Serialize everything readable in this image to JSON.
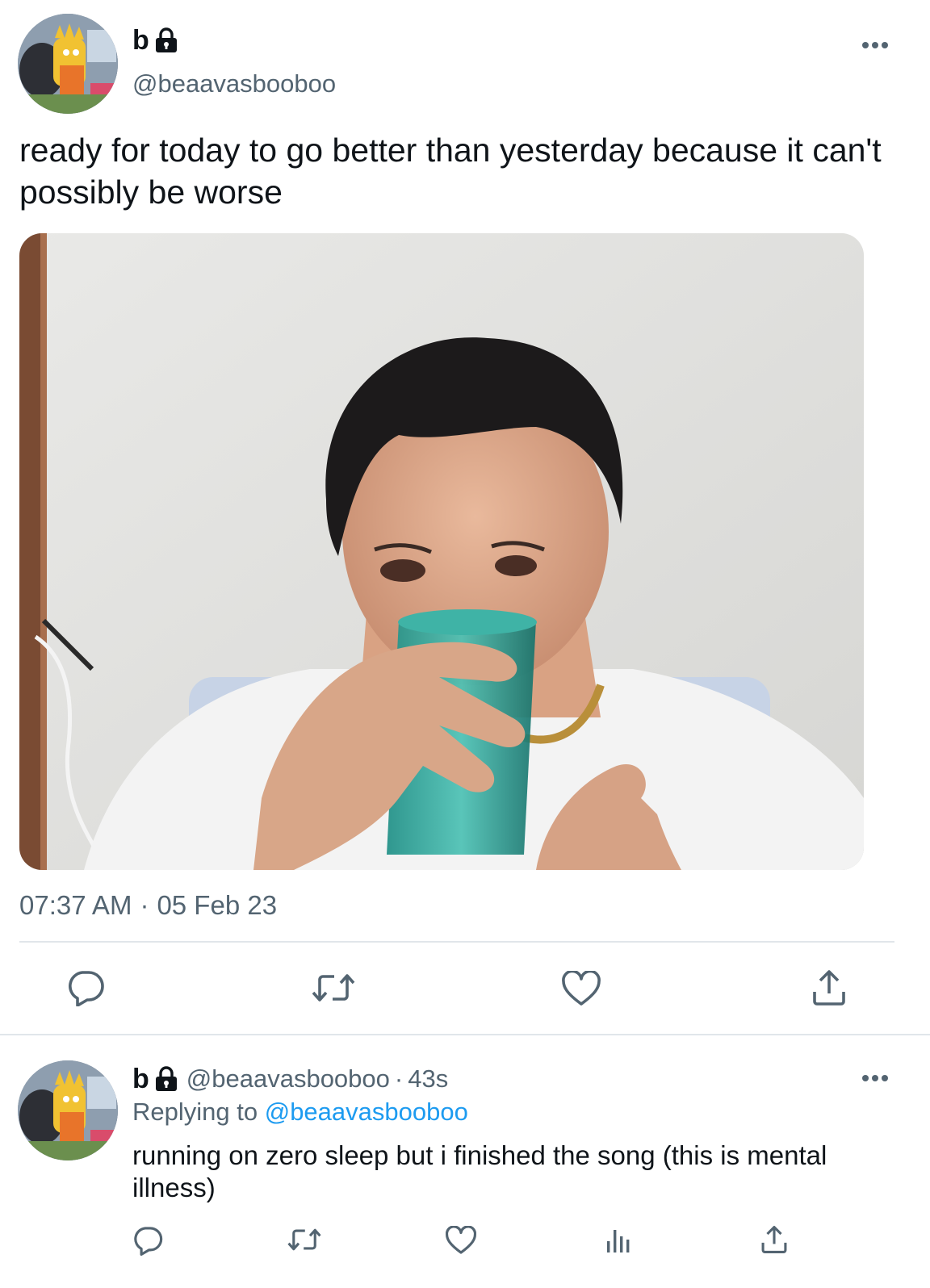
{
  "tweet": {
    "author_name": "b",
    "author_handle": "@beaavasbooboo",
    "text": "ready for today to go better than yesterday because it can't possibly be worse",
    "time": "07:37 AM",
    "separator": "·",
    "date": "05 Feb 23",
    "icons": {
      "lock": "lock-icon",
      "more": "more-icon",
      "reply": "reply-icon",
      "retweet": "retweet-icon",
      "like": "like-icon",
      "share": "share-icon"
    }
  },
  "reply": {
    "author_name": "b",
    "author_handle": "@beaavasbooboo",
    "separator": "·",
    "age": "43s",
    "replying_prefix": "Replying to",
    "replying_to": "@beaavasbooboo",
    "text": "running on zero sleep but i finished the song (this is mental illness)",
    "icons": {
      "reply": "reply-icon",
      "retweet": "retweet-icon",
      "like": "like-icon",
      "views": "views-icon",
      "share": "share-icon"
    }
  },
  "colors": {
    "text": "#0f1419",
    "secondary": "#536471",
    "link": "#1d9bf0",
    "divider": "#e1e6ea"
  }
}
